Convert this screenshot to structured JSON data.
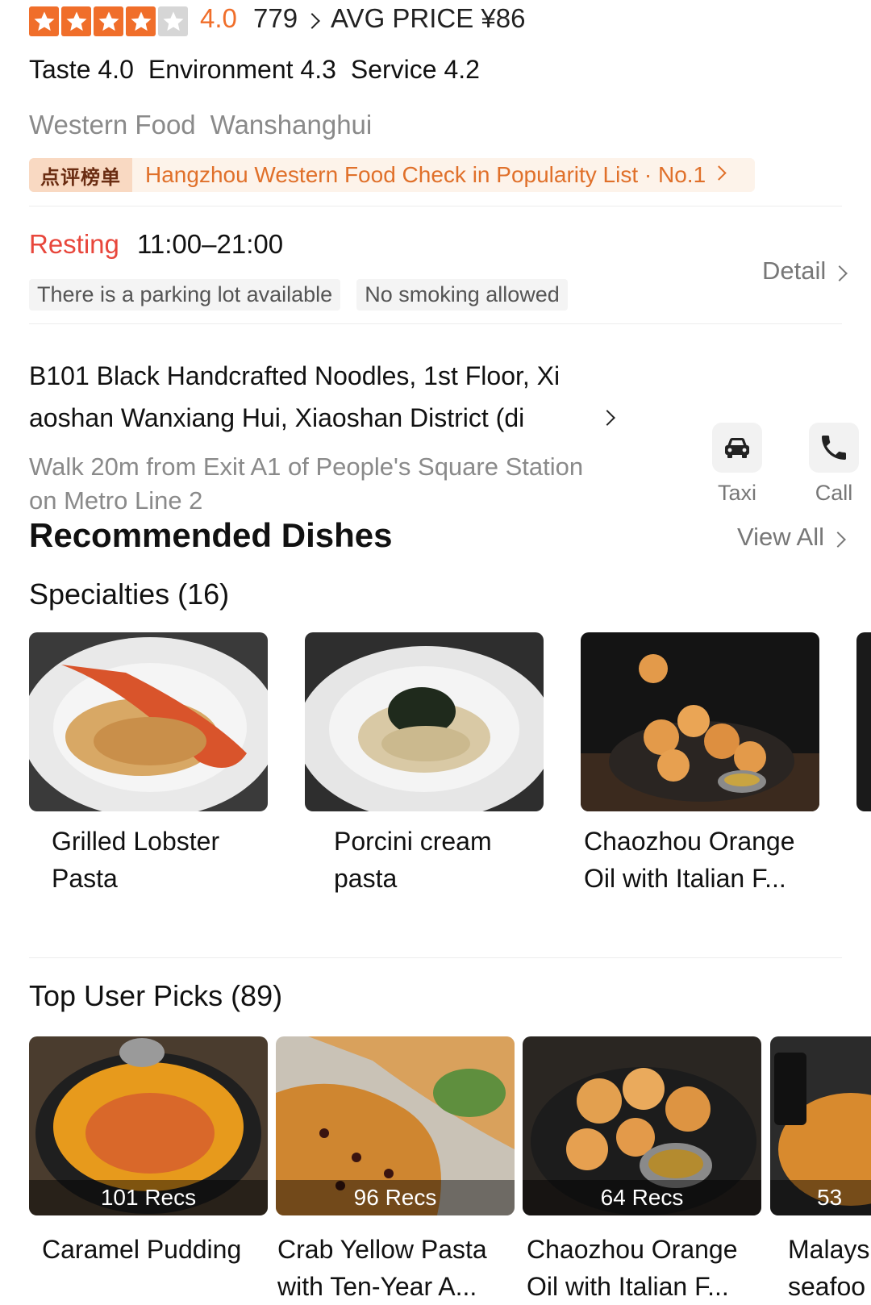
{
  "rating": {
    "score": "4.0",
    "stars": 4,
    "stars_max": 5,
    "review_count": "779",
    "avg_price": "AVG PRICE ¥86"
  },
  "scores": {
    "taste": "Taste 4.0",
    "environment": "Environment 4.3",
    "service": "Service 4.2"
  },
  "categories": {
    "cuisine": "Western Food",
    "location": "Wanshanghui"
  },
  "ranking": {
    "badge": "点评榜单",
    "text": "Hangzhou Western Food Check in Popularity List · No.1"
  },
  "hours": {
    "status": "Resting",
    "time": "11:00–21:00",
    "tags": [
      "There is a parking lot available",
      "No smoking allowed"
    ],
    "detail_label": "Detail"
  },
  "address": {
    "line1": "B101 Black Handcrafted Noodles, 1st Floor, Xi",
    "line2": "aoshan Wanxiang Hui, Xiaoshan District (di",
    "directions_line1": "Walk 20m from Exit A1 of People's Square Station",
    "directions_line2": "on Metro Line 2"
  },
  "actions": {
    "taxi": "Taxi",
    "call": "Call"
  },
  "recommended": {
    "title": "Recommended Dishes",
    "view_all": "View All",
    "specialties_title": "Specialties (16)",
    "specialties": [
      {
        "name_l1": "Grilled Lobster",
        "name_l2": "Pasta"
      },
      {
        "name_l1": "Porcini cream",
        "name_l2": "pasta"
      },
      {
        "name_l1": "Chaozhou Orange",
        "name_l2": "Oil with Italian F..."
      }
    ],
    "picks_title": "Top User Picks (89)",
    "picks": [
      {
        "recs": "101 Recs",
        "name_l1": "Caramel Pudding",
        "name_l2": ""
      },
      {
        "recs": "96 Recs",
        "name_l1": "Crab Yellow Pasta",
        "name_l2": "with Ten-Year A..."
      },
      {
        "recs": "64 Recs",
        "name_l1": "Chaozhou Orange",
        "name_l2": "Oil with Italian F..."
      },
      {
        "recs": "53",
        "name_l1": "Malays",
        "name_l2": "seafoo"
      }
    ]
  },
  "colors": {
    "accent": "#F06E2A",
    "status_red": "#E8473C",
    "secondary_text": "#8a8a8a"
  }
}
